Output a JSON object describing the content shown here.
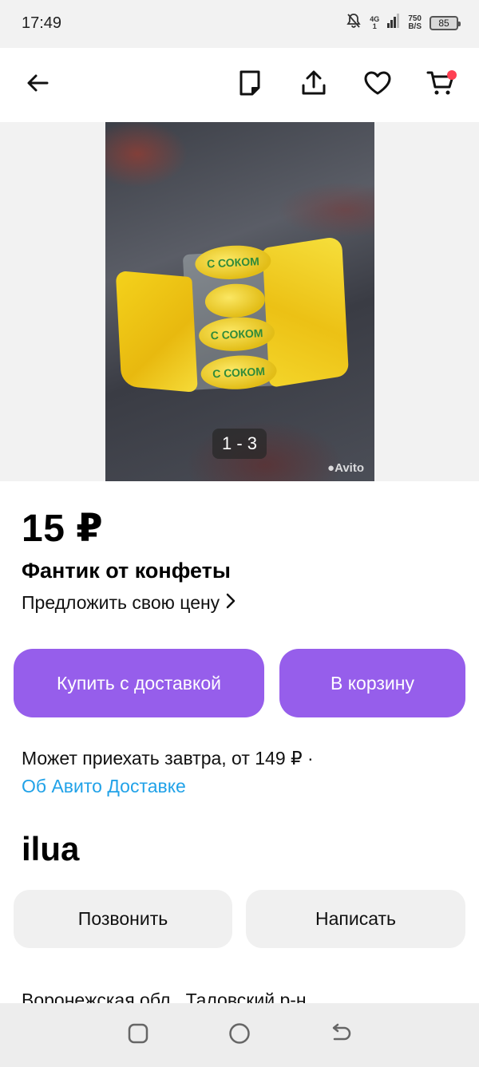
{
  "status_bar": {
    "time": "17:49",
    "network": "4G",
    "network_sub": "1",
    "speed_value": "750",
    "speed_unit": "B/S",
    "battery": "85"
  },
  "toolbar": {
    "icons": [
      "back-arrow-icon",
      "note-icon",
      "share-icon",
      "heart-icon",
      "cart-icon"
    ],
    "cart_badge_color": "#ff4053"
  },
  "gallery": {
    "counter": "1 - 3",
    "watermark": "Avito",
    "candy_text": "С СОКОМ"
  },
  "listing": {
    "price": "15 ₽",
    "title": "Фантик от конфеты",
    "offer_price": "Предложить свою цену",
    "offer_chevron": "›"
  },
  "actions": {
    "buy_with_delivery": "Купить с доставкой",
    "add_to_cart": "В корзину",
    "accent_color": "#965eeb"
  },
  "delivery": {
    "info": "Может приехать завтра, от 149 ₽ ·",
    "link": "Об Авито Доставке",
    "link_color": "#21a2e8"
  },
  "seller": {
    "name": "ilua",
    "call": "Позвонить",
    "message": "Написать"
  },
  "location": {
    "address": "Воронежская обл., Таловский р-н"
  }
}
